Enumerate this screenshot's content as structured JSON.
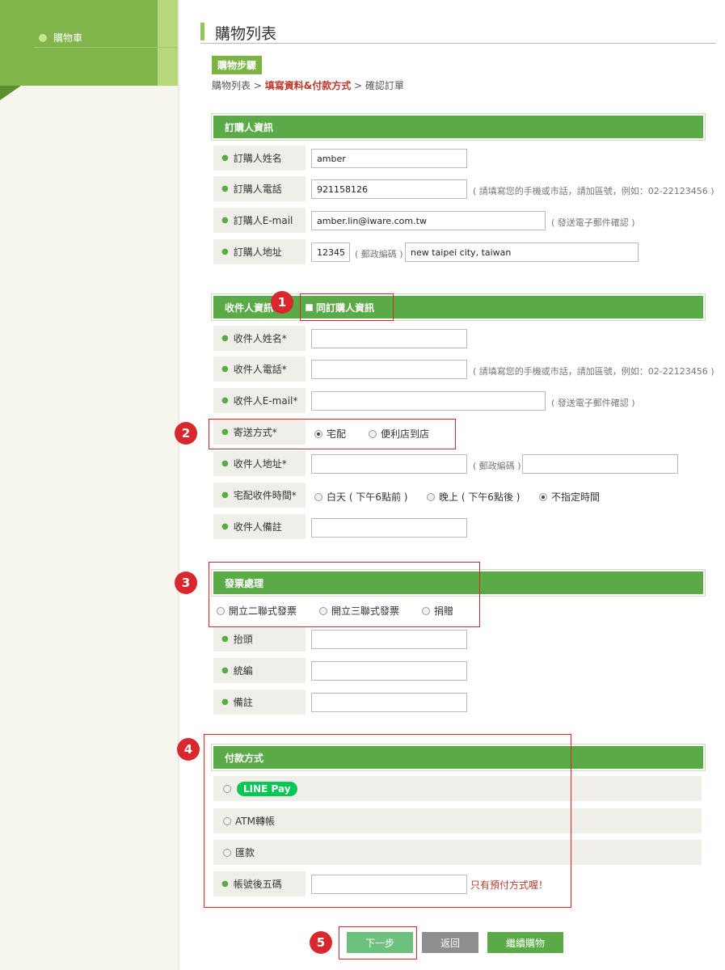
{
  "sidebar": {
    "item": "購物車"
  },
  "page": {
    "title": "購物列表"
  },
  "steps": {
    "badge": "購物步驟",
    "step1": "購物列表",
    "step2": "填寫資料&付款方式",
    "step3": "確認訂單",
    "sep": ">"
  },
  "buyer": {
    "header": "訂購人資訊",
    "name_label": "訂購人姓名",
    "name_value": "amber",
    "phone_label": "訂購人電話",
    "phone_value": "921158126",
    "phone_hint": "( 請填寫您的手機或市話，請加區號，例如：02-22123456 )",
    "email_label": "訂購人E-mail",
    "email_value": "amber.lin@iware.com.tw",
    "email_hint": "( 發送電子郵件確認 )",
    "address_label": "訂購人地址",
    "zip_value": "12345",
    "zip_hint": "( 郵政編碼 )",
    "address_value": "new taipei city, taiwan"
  },
  "receiver": {
    "header": "收件人資訊",
    "same_as_buyer": "同訂購人資訊",
    "name_label": "收件人姓名*",
    "phone_label": "收件人電話*",
    "phone_hint": "( 請填寫您的手機或市話，請加區號，例如：02-22123456 )",
    "email_label": "收件人E-mail*",
    "email_hint": "( 發送電子郵件確認 )",
    "shipping_label": "寄送方式*",
    "shipping_opt1": "宅配",
    "shipping_opt2": "便利店到店",
    "address_label": "收件人地址*",
    "zip_hint_open": "( 郵政編碼 )",
    "time_label": "宅配收件時間*",
    "time_opt1": "白天 ( 下午6點前 )",
    "time_opt2": "晚上 ( 下午6點後 )",
    "time_opt3": "不指定時間",
    "note_label": "收件人備註"
  },
  "invoice": {
    "header": "發票處理",
    "opt1": "開立二聯式發票",
    "opt2": "開立三聯式發票",
    "opt3": "捐贈",
    "title_label": "抬頭",
    "tax_label": "統編",
    "note_label": "備註"
  },
  "payment": {
    "header": "付款方式",
    "linepay": "LINE Pay",
    "atm": "ATM轉帳",
    "remit": "匯款",
    "last5_label": "帳號後五碼",
    "warn": "只有預付方式喔！"
  },
  "buttons": {
    "next": "下一步",
    "back": "返回",
    "continue": "繼續購物"
  },
  "badges": [
    "1",
    "2",
    "3",
    "4",
    "5"
  ],
  "colors": {
    "green": "#5aab47",
    "red": "#d9272e",
    "sidebar": "#7fb54a"
  }
}
